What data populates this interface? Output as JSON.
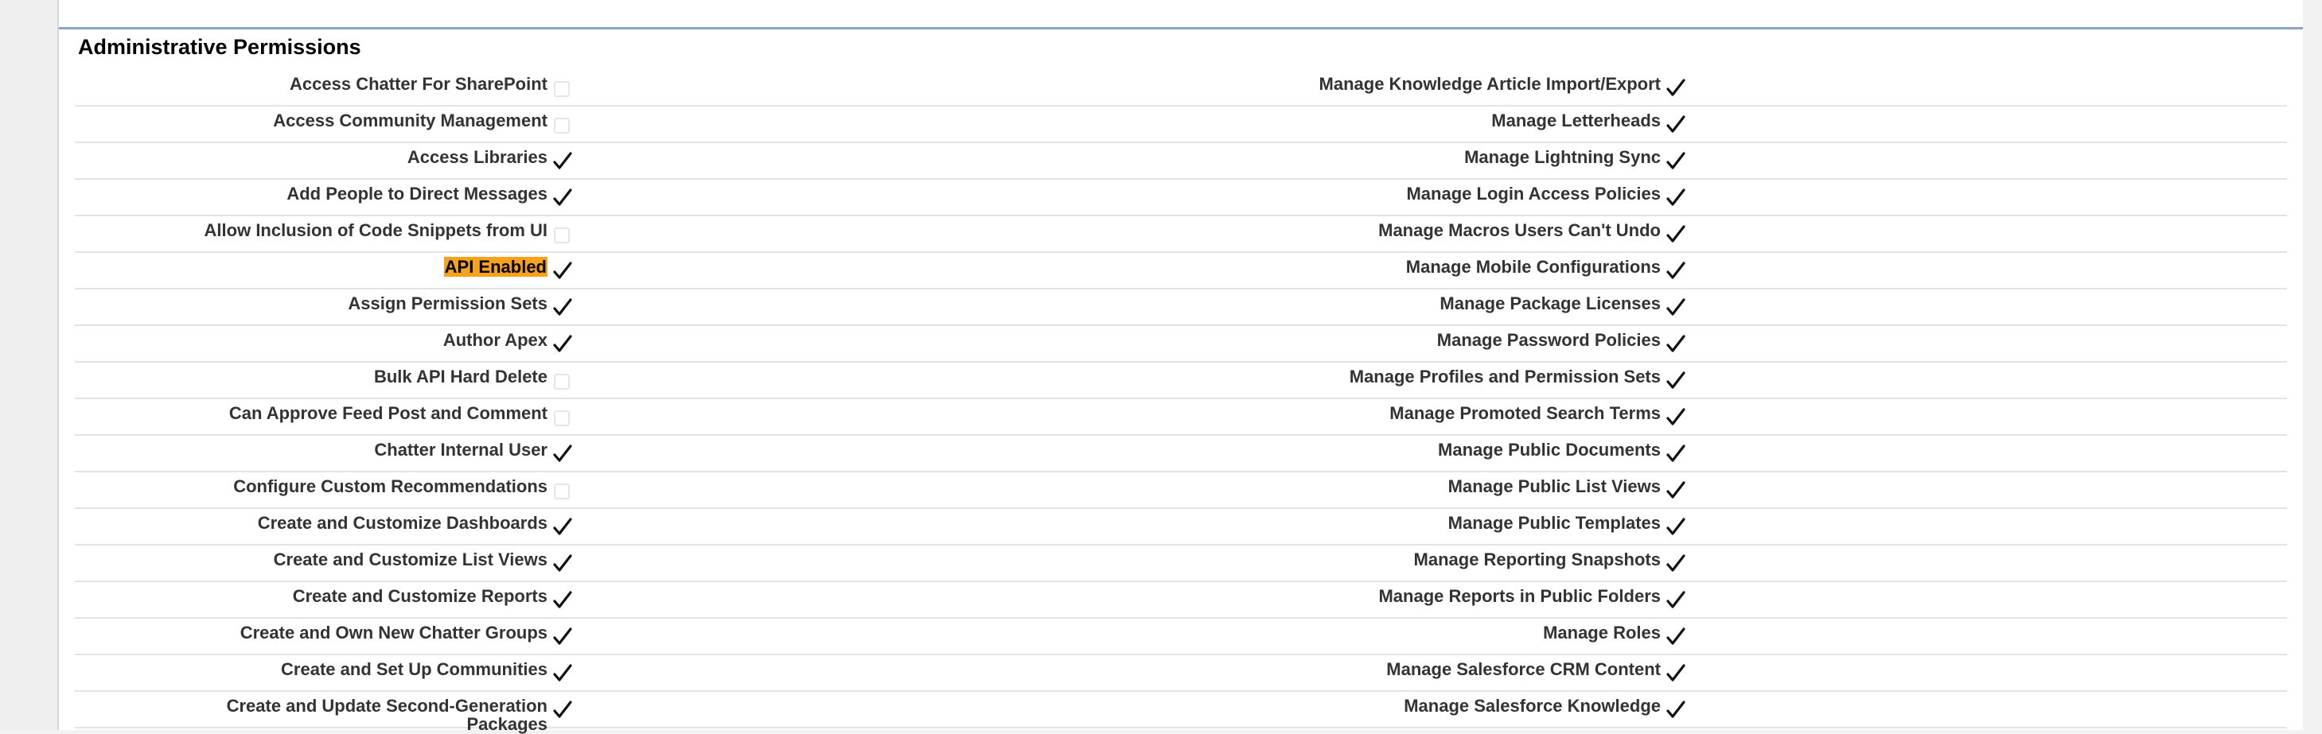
{
  "section": {
    "title": "Administrative Permissions"
  },
  "rows": [
    {
      "left": {
        "label": "Access Chatter For SharePoint",
        "checked": false
      },
      "right": {
        "label": "Manage Knowledge Article Import/Export",
        "checked": true
      }
    },
    {
      "left": {
        "label": "Access Community Management",
        "checked": false
      },
      "right": {
        "label": "Manage Letterheads",
        "checked": true
      }
    },
    {
      "left": {
        "label": "Access Libraries",
        "checked": true
      },
      "right": {
        "label": "Manage Lightning Sync",
        "checked": true
      }
    },
    {
      "left": {
        "label": "Add People to Direct Messages",
        "checked": true
      },
      "right": {
        "label": "Manage Login Access Policies",
        "checked": true
      }
    },
    {
      "left": {
        "label": "Allow Inclusion of Code Snippets from UI",
        "checked": false
      },
      "right": {
        "label": "Manage Macros Users Can't Undo",
        "checked": true
      }
    },
    {
      "left": {
        "label": "API Enabled",
        "checked": true,
        "highlighted": true
      },
      "right": {
        "label": "Manage Mobile Configurations",
        "checked": true
      }
    },
    {
      "left": {
        "label": "Assign Permission Sets",
        "checked": true
      },
      "right": {
        "label": "Manage Package Licenses",
        "checked": true
      }
    },
    {
      "left": {
        "label": "Author Apex",
        "checked": true
      },
      "right": {
        "label": "Manage Password Policies",
        "checked": true
      }
    },
    {
      "left": {
        "label": "Bulk API Hard Delete",
        "checked": false
      },
      "right": {
        "label": "Manage Profiles and Permission Sets",
        "checked": true
      }
    },
    {
      "left": {
        "label": "Can Approve Feed Post and Comment",
        "checked": false
      },
      "right": {
        "label": "Manage Promoted Search Terms",
        "checked": true
      }
    },
    {
      "left": {
        "label": "Chatter Internal User",
        "checked": true
      },
      "right": {
        "label": "Manage Public Documents",
        "checked": true
      }
    },
    {
      "left": {
        "label": "Configure Custom Recommendations",
        "checked": false
      },
      "right": {
        "label": "Manage Public List Views",
        "checked": true
      }
    },
    {
      "left": {
        "label": "Create and Customize Dashboards",
        "checked": true
      },
      "right": {
        "label": "Manage Public Templates",
        "checked": true
      }
    },
    {
      "left": {
        "label": "Create and Customize List Views",
        "checked": true
      },
      "right": {
        "label": "Manage Reporting Snapshots",
        "checked": true
      }
    },
    {
      "left": {
        "label": "Create and Customize Reports",
        "checked": true
      },
      "right": {
        "label": "Manage Reports in Public Folders",
        "checked": true
      }
    },
    {
      "left": {
        "label": "Create and Own New Chatter Groups",
        "checked": true
      },
      "right": {
        "label": "Manage Roles",
        "checked": true
      }
    },
    {
      "left": {
        "label": "Create and Set Up Communities",
        "checked": true
      },
      "right": {
        "label": "Manage Salesforce CRM Content",
        "checked": true
      }
    },
    {
      "left": {
        "label": "Create and Update Second-Generation Packages",
        "checked": true
      },
      "right": {
        "label": "Manage Salesforce Knowledge",
        "checked": true
      }
    }
  ]
}
